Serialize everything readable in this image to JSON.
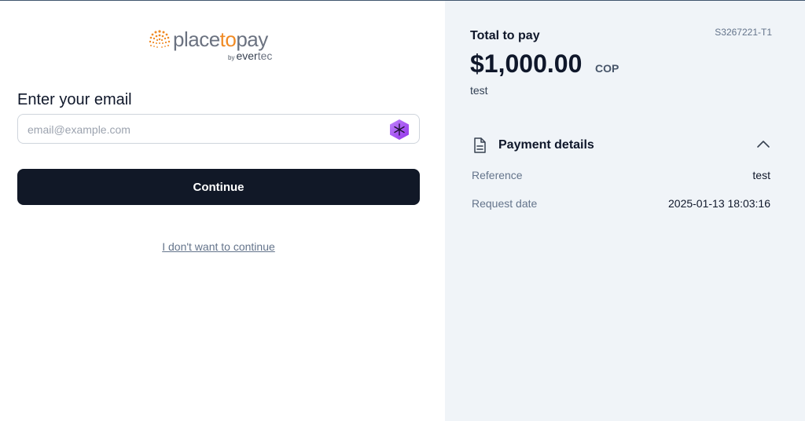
{
  "brand": {
    "logo_place": "place",
    "logo_to": "to",
    "logo_pay": "pay",
    "logo_by": "by",
    "logo_ever": "ever",
    "logo_tec": "tec",
    "accent_color": "#f08a24"
  },
  "email_form": {
    "title": "Enter your email",
    "placeholder": "email@example.com",
    "value": "",
    "continue_label": "Continue",
    "cancel_label": "I don't want to continue"
  },
  "summary": {
    "total_label": "Total to pay",
    "order_id": "S3267221-T1",
    "amount": "$1,000.00",
    "currency": "COP",
    "description": "test"
  },
  "payment_details": {
    "title": "Payment details",
    "rows": [
      {
        "label": "Reference",
        "value": "test"
      },
      {
        "label": "Request date",
        "value": "2025-01-13 18:03:16"
      }
    ]
  },
  "icons": {
    "logo": "dotted-sunburst-icon",
    "extension": "hexagon-extension-icon",
    "details": "document-icon",
    "collapse": "chevron-up-icon"
  }
}
